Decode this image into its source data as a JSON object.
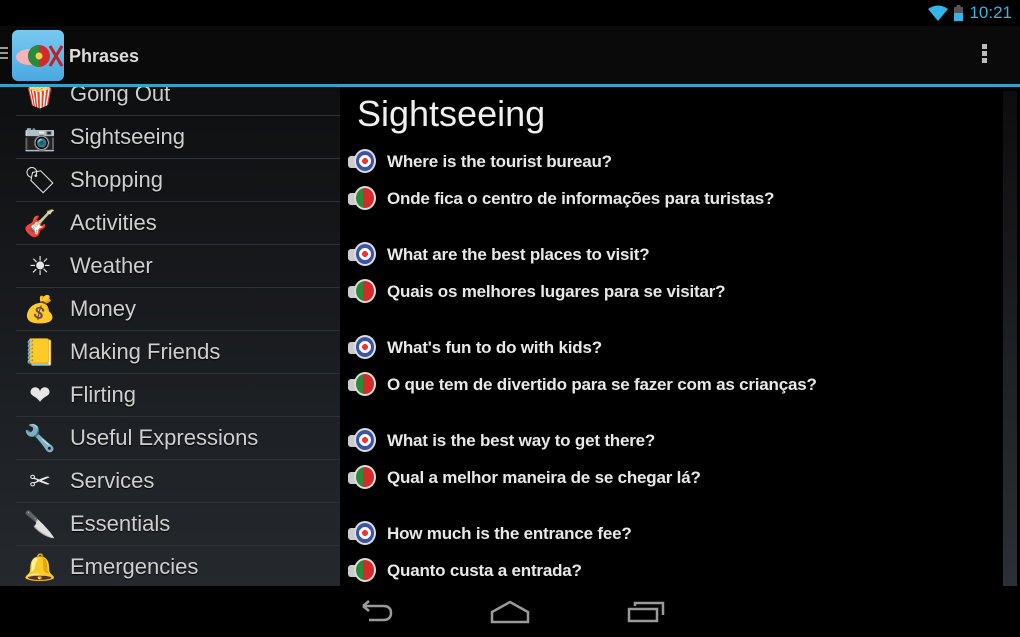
{
  "status_bar": {
    "time": "10:21",
    "wifi_icon": "wifi-icon",
    "battery_icon": "battery-icon"
  },
  "action_bar": {
    "title": "Phrases",
    "menu_icon": "drawer-icon",
    "overflow_icon": "overflow-menu-icon"
  },
  "sidebar": {
    "items": [
      {
        "label": "Going Out",
        "icon": "popcorn-icon",
        "glyph": "🍿"
      },
      {
        "label": "Sightseeing",
        "icon": "camera-icon",
        "glyph": "📷"
      },
      {
        "label": "Shopping",
        "icon": "tags-icon",
        "glyph": "🏷"
      },
      {
        "label": "Activities",
        "icon": "guitar-icon",
        "glyph": "🎸"
      },
      {
        "label": "Weather",
        "icon": "sun-icon",
        "glyph": "☀"
      },
      {
        "label": "Money",
        "icon": "money-icon",
        "glyph": "💰"
      },
      {
        "label": "Making Friends",
        "icon": "address-book-icon",
        "glyph": "📒"
      },
      {
        "label": "Flirting",
        "icon": "heart-icon",
        "glyph": "❤"
      },
      {
        "label": "Useful Expressions",
        "icon": "tools-icon",
        "glyph": "🔧"
      },
      {
        "label": "Services",
        "icon": "scissors-icon",
        "glyph": "✂"
      },
      {
        "label": "Essentials",
        "icon": "pocket-knife-icon",
        "glyph": "🔪"
      },
      {
        "label": "Emergencies",
        "icon": "alarm-bell-icon",
        "glyph": "🔔"
      }
    ]
  },
  "content": {
    "title": "Sightseeing",
    "phrases": [
      {
        "en": "Where is the tourist bureau?",
        "pt": "Onde fica o centro de informações para turistas?"
      },
      {
        "en": "What are the best places to visit?",
        "pt": "Quais os melhores lugares para se visitar?"
      },
      {
        "en": "What's fun to do with kids?",
        "pt": "O que tem de divertido para se fazer com as crianças?"
      },
      {
        "en": "What is the best way to get there?",
        "pt": "Qual a melhor maneira de se chegar lá?"
      },
      {
        "en": "How much is the entrance fee?",
        "pt": "Quanto custa a entrada?"
      }
    ]
  },
  "nav_bar": {
    "back": "back-icon",
    "home": "home-icon",
    "recents": "recents-icon"
  },
  "colors": {
    "accent": "#33b5e5",
    "divider": "#33a3c8"
  }
}
